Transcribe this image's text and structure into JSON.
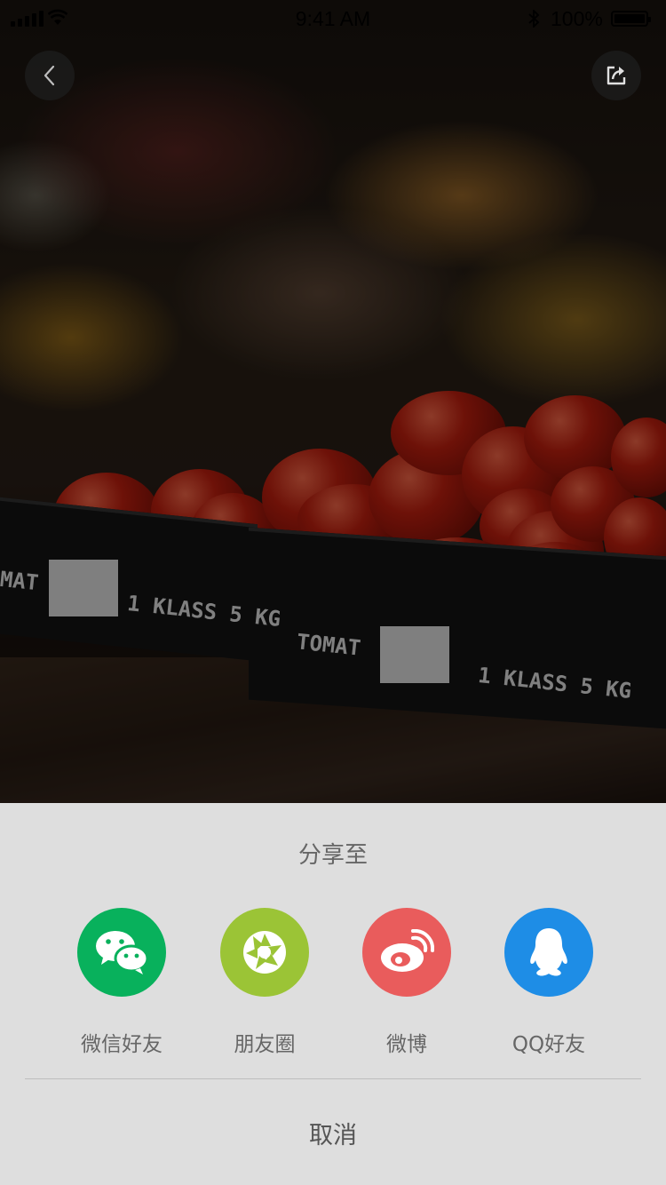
{
  "status_bar": {
    "time": "9:41 AM",
    "battery_text": "100%"
  },
  "nav": {
    "back_icon": "chevron-left-icon",
    "share_icon": "share-icon"
  },
  "photo": {
    "label_left_product": "MAT",
    "label_left_class": "1 KLASS 5 KG",
    "label_right_product": "TOMAT",
    "label_right_class": "1 KLASS 5 KG"
  },
  "share_sheet": {
    "title": "分享至",
    "options": [
      {
        "label": "微信好友",
        "icon": "wechat-icon",
        "color": "#08b15c"
      },
      {
        "label": "朋友圈",
        "icon": "moments-icon",
        "color": "#9bc436"
      },
      {
        "label": "微博",
        "icon": "weibo-icon",
        "color": "#e95c5c"
      },
      {
        "label": "QQ好友",
        "icon": "qq-icon",
        "color": "#1e8de6"
      }
    ],
    "cancel_label": "取消"
  }
}
